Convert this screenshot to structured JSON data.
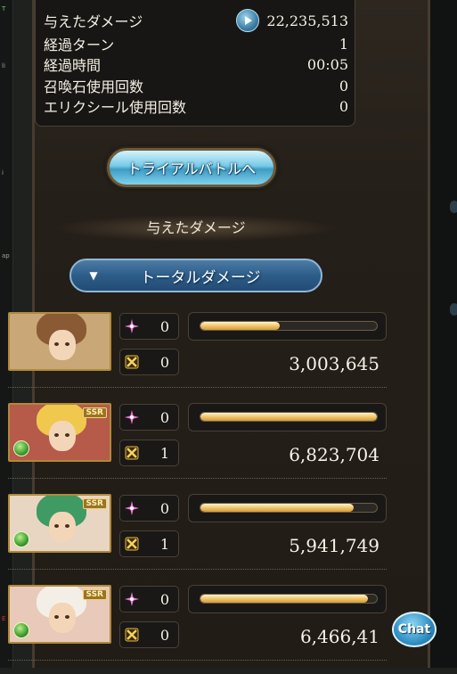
{
  "summary": {
    "damage_label": "与えたダメージ",
    "damage_value": "22,235,513",
    "turns_label": "経過ターン",
    "turns_value": "1",
    "time_label": "経過時間",
    "time_value": "00:05",
    "summon_label": "召喚石使用回数",
    "summon_value": "0",
    "elixir_label": "エリクシール使用回数",
    "elixir_value": "0"
  },
  "trial_button": "トライアルバトルへ",
  "section_title": "与えたダメージ",
  "dropdown": {
    "selected": "トータルダメージ"
  },
  "characters": [
    {
      "pink_count": "0",
      "gold_count": "0",
      "bar_fraction": 0.45,
      "damage": "3,003,645",
      "portrait": "duo-portrait",
      "ssr": "",
      "element": ""
    },
    {
      "pink_count": "0",
      "gold_count": "1",
      "bar_fraction": 1.0,
      "damage": "6,823,704",
      "portrait": "blonde-portrait",
      "ssr": "SSR",
      "element": "wind-element-icon"
    },
    {
      "pink_count": "0",
      "gold_count": "1",
      "bar_fraction": 0.87,
      "damage": "5,941,749",
      "portrait": "green-hair-portrait",
      "ssr": "SSR",
      "element": "wind-element-icon"
    },
    {
      "pink_count": "0",
      "gold_count": "0",
      "bar_fraction": 0.95,
      "damage": "6,466,41",
      "portrait": "white-hair-portrait",
      "ssr": "SSR",
      "element": "wind-element-icon"
    }
  ],
  "chat_button": "Chat",
  "colors": {
    "accent_blue": "#3e9cc4",
    "bar_gold": "#f1c76a",
    "wind_green": "#3e9c2e"
  }
}
